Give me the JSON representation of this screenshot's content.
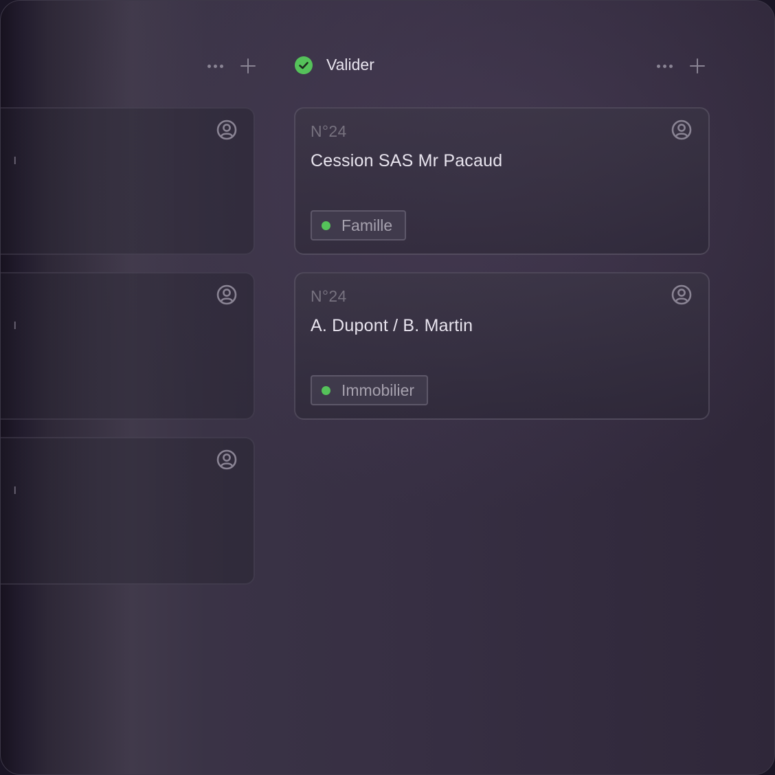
{
  "board": {
    "columns": [
      {
        "title": "",
        "actions": {
          "more_icon": "more-dots-icon",
          "add_icon": "plus-icon"
        },
        "cards": [
          {
            "avatar_icon": "user-circle-icon"
          },
          {
            "avatar_icon": "user-circle-icon"
          },
          {
            "avatar_icon": "user-circle-icon"
          }
        ]
      },
      {
        "title": "Valider",
        "status_icon": "check-circle-icon",
        "status_color": "#55c25a",
        "actions": {
          "more_icon": "more-dots-icon",
          "add_icon": "plus-icon"
        },
        "cards": [
          {
            "number": "N°24",
            "title": "Cession SAS Mr Pacaud",
            "tag": {
              "label": "Famille",
              "color": "#55c25a"
            },
            "avatar_icon": "user-circle-icon"
          },
          {
            "number": "N°24",
            "title": "A. Dupont / B. Martin",
            "tag": {
              "label": "Immobilier",
              "color": "#55c25a"
            },
            "avatar_icon": "user-circle-icon"
          }
        ]
      }
    ]
  }
}
